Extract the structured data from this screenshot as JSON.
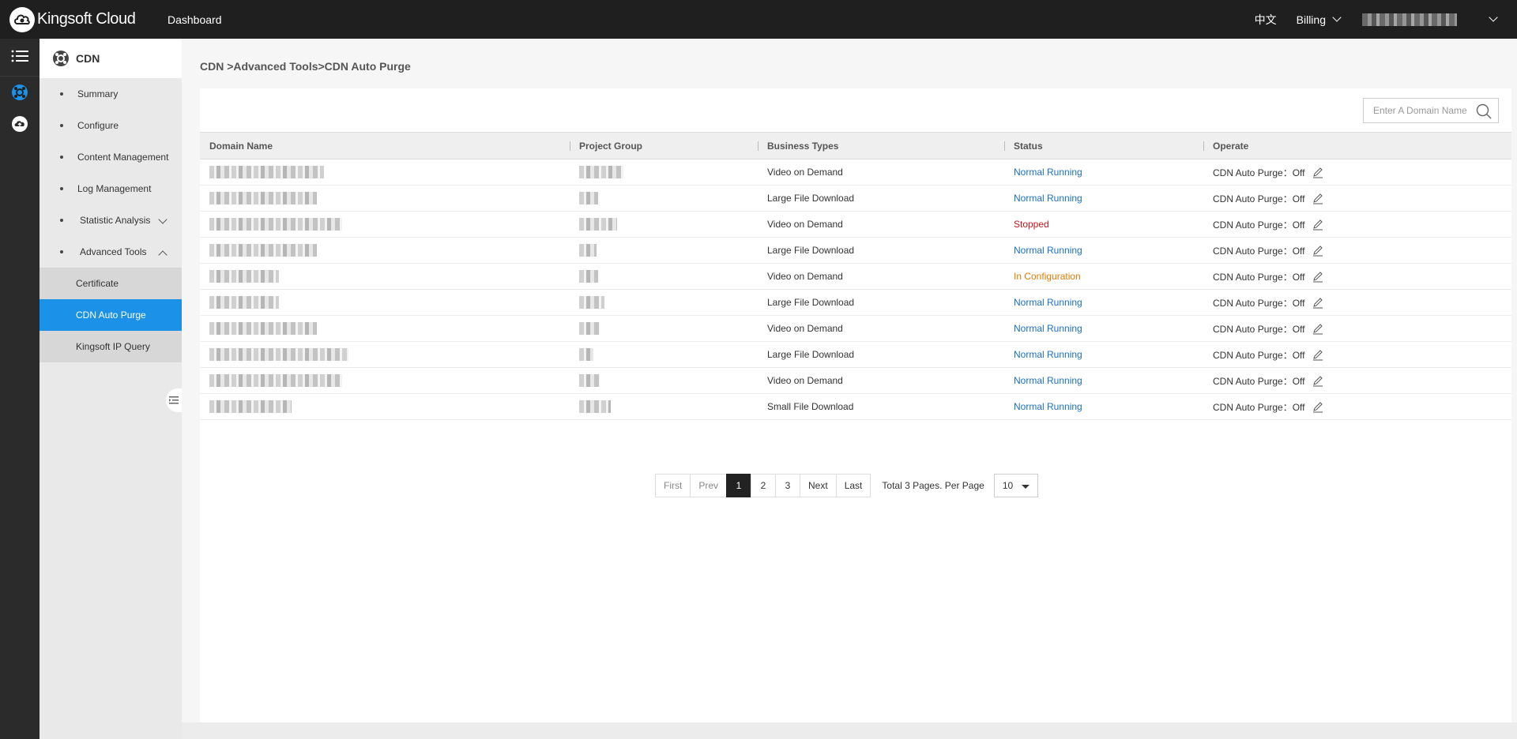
{
  "topbar": {
    "brand": "Kingsoft Cloud",
    "dashboard": "Dashboard",
    "lang": "中文",
    "billing": "Billing"
  },
  "sidebar": {
    "title": "CDN",
    "items": [
      {
        "label": "Summary"
      },
      {
        "label": "Configure"
      },
      {
        "label": "Content Management"
      },
      {
        "label": "Log Management"
      },
      {
        "label": "Statistic Analysis"
      },
      {
        "label": "Advanced Tools"
      }
    ],
    "subitems": [
      {
        "label": "Certificate"
      },
      {
        "label": "CDN Auto Purge"
      },
      {
        "label": "Kingsoft IP Query"
      }
    ]
  },
  "breadcrumb": "CDN >Advanced Tools>CDN Auto Purge",
  "search": {
    "placeholder": "Enter A Domain Name"
  },
  "table": {
    "headers": [
      "Domain Name",
      "Project Group",
      "Business Types",
      "Status",
      "Operate"
    ],
    "rows": [
      {
        "business": "Video on Demand",
        "status": "Normal Running",
        "operate": "CDN Auto Purge：Off"
      },
      {
        "business": "Large File Download",
        "status": "Normal Running",
        "operate": "CDN Auto Purge：Off"
      },
      {
        "business": "Video on Demand",
        "status": "Stopped",
        "operate": "CDN Auto Purge：Off"
      },
      {
        "business": "Large File Download",
        "status": "Normal Running",
        "operate": "CDN Auto Purge：Off"
      },
      {
        "business": "Video on Demand",
        "status": "In Configuration",
        "operate": "CDN Auto Purge：Off"
      },
      {
        "business": "Large File Download",
        "status": "Normal Running",
        "operate": "CDN Auto Purge：Off"
      },
      {
        "business": "Video on Demand",
        "status": "Normal Running",
        "operate": "CDN Auto Purge：Off"
      },
      {
        "business": "Large File Download",
        "status": "Normal Running",
        "operate": "CDN Auto Purge：Off"
      },
      {
        "business": "Video on Demand",
        "status": "Normal Running",
        "operate": "CDN Auto Purge：Off"
      },
      {
        "business": "Small File Download",
        "status": "Normal Running",
        "operate": "CDN Auto Purge：Off"
      }
    ]
  },
  "pagination": {
    "first": "First",
    "prev": "Prev",
    "pages": [
      "1",
      "2",
      "3"
    ],
    "current": "1",
    "next": "Next",
    "last": "Last",
    "total": "Total 3 Pages. Per Page",
    "per_page": "10"
  },
  "colors": {
    "accent": "#1b91e8",
    "running": "#1b6fc4",
    "stopped": "#c4141c",
    "configuring": "#e07a06"
  }
}
